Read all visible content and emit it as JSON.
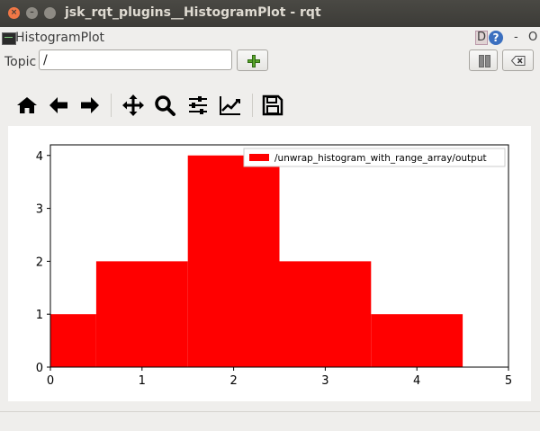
{
  "window": {
    "title": "jsk_rqt_plugins__HistogramPlot - rqt"
  },
  "plugin": {
    "title": "HistogramPlot",
    "d_label": "D",
    "help_label": "?",
    "minimize_label": "-",
    "close_label": "O"
  },
  "topic": {
    "label": "Topic",
    "value": "/"
  },
  "toolbar": {
    "icons": [
      "home-icon",
      "back-icon",
      "forward-icon",
      "pan-icon",
      "zoom-icon",
      "subplots-icon",
      "edit-curve-icon",
      "save-icon"
    ]
  },
  "colors": {
    "bar": "#ff0000",
    "titlebar": "#3c3b37",
    "close": "#f07746"
  },
  "chart_data": {
    "type": "bar",
    "bins": [
      {
        "x0": 0.0,
        "x1": 0.5,
        "value": 1
      },
      {
        "x0": 0.5,
        "x1": 1.5,
        "value": 2
      },
      {
        "x0": 1.5,
        "x1": 2.5,
        "value": 4
      },
      {
        "x0": 2.5,
        "x1": 3.5,
        "value": 2
      },
      {
        "x0": 3.5,
        "x1": 4.5,
        "value": 1
      }
    ],
    "series": [
      {
        "name": "/unwrap_histogram_with_range_array/output"
      }
    ],
    "xlim": [
      0,
      5
    ],
    "ylim": [
      0,
      4.2
    ],
    "xticks": [
      "0",
      "1",
      "2",
      "3",
      "4",
      "5"
    ],
    "yticks": [
      "0",
      "1",
      "2",
      "3",
      "4"
    ],
    "legend": "top-right",
    "grid": false
  }
}
